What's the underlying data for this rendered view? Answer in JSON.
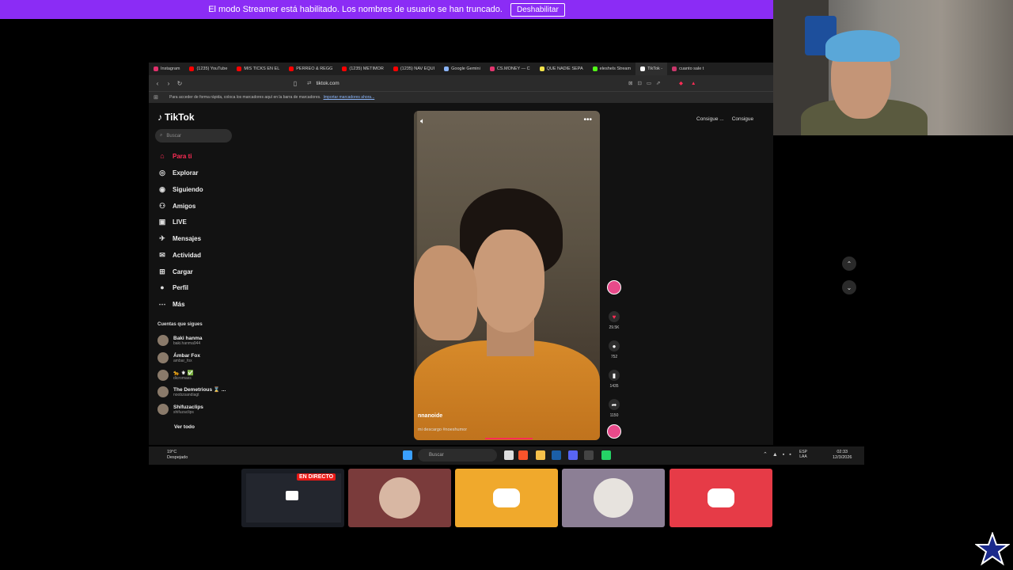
{
  "banner": {
    "message": "El modo Streamer está habilitado. Los nombres de usuario se han truncado.",
    "button": "Deshabilitar"
  },
  "browser": {
    "tabs": [
      {
        "label": "Instagram",
        "color": "#e1306c"
      },
      {
        "label": "(1235) YouTube",
        "color": "#ff0000"
      },
      {
        "label": "MIS TICKS EN EL",
        "color": "#ff0000"
      },
      {
        "label": "PERREO & REGG",
        "color": "#ff0000"
      },
      {
        "label": "(1235) METIMOR",
        "color": "#ff0000"
      },
      {
        "label": "(1235) NAV EQUI",
        "color": "#ff0000"
      },
      {
        "label": "Google Gemini",
        "color": "#8ab4f8"
      },
      {
        "label": "CS.MONEY — C",
        "color": "#e3356f"
      },
      {
        "label": "QUE NADIE SEPA",
        "color": "#f2e34a"
      },
      {
        "label": "eleshels Stream",
        "color": "#53fc18"
      },
      {
        "label": "TikTok - ",
        "color": "#ffffff"
      },
      {
        "label": "cuanto sale t",
        "color": "#c9376b"
      }
    ],
    "url": "tiktok.com",
    "bookmarks_hint": "Para acceder de forma rápida, coloca los marcadores aquí en la barra de marcadores.",
    "bookmarks_link": "Importar marcadores ahora..."
  },
  "tiktok": {
    "logo": "TikTok",
    "search_placeholder": "Buscar",
    "nav": [
      {
        "label": "Para ti",
        "icon": "home-icon"
      },
      {
        "label": "Explorar",
        "icon": "compass-icon"
      },
      {
        "label": "Siguiendo",
        "icon": "following-icon"
      },
      {
        "label": "Amigos",
        "icon": "friends-icon"
      },
      {
        "label": "LIVE",
        "icon": "live-icon"
      },
      {
        "label": "Mensajes",
        "icon": "messages-icon"
      },
      {
        "label": "Actividad",
        "icon": "activity-icon"
      },
      {
        "label": "Cargar",
        "icon": "upload-icon"
      },
      {
        "label": "Perfil",
        "icon": "profile-icon"
      },
      {
        "label": "Más",
        "icon": "more-icon"
      }
    ],
    "following_title": "Cuentas que sigues",
    "following": [
      {
        "name": "Baki hanma",
        "handle": "baki.hanma944"
      },
      {
        "name": "Ámbar Fox",
        "handle": "ambar_fox"
      },
      {
        "name": "🐆 ⚜ ✅",
        "handle": "dicromass"
      },
      {
        "name": "The Demetrious ⌛ ...",
        "handle": "noobzsandiagt"
      },
      {
        "name": "Shifuzaclips",
        "handle": "shifuzaclips"
      }
    ],
    "see_all": "Ver todo",
    "video": {
      "username": "nnanoide",
      "description": "mi descargo #noeshumor"
    },
    "actions": {
      "likes": "29.5K",
      "comments": "752",
      "saves": "1435",
      "shares": "1150"
    },
    "get_app": [
      "Consigue ...",
      "Consigue"
    ]
  },
  "taskbar": {
    "weather_temp": "19°C",
    "weather_desc": "Despejado",
    "search_placeholder": "Buscar",
    "lang_top": "ESP",
    "lang_bottom": "LAA",
    "time": "02:33",
    "date": "12/3/2026"
  },
  "stream": {
    "live_badge": "EN DIRECTO"
  }
}
